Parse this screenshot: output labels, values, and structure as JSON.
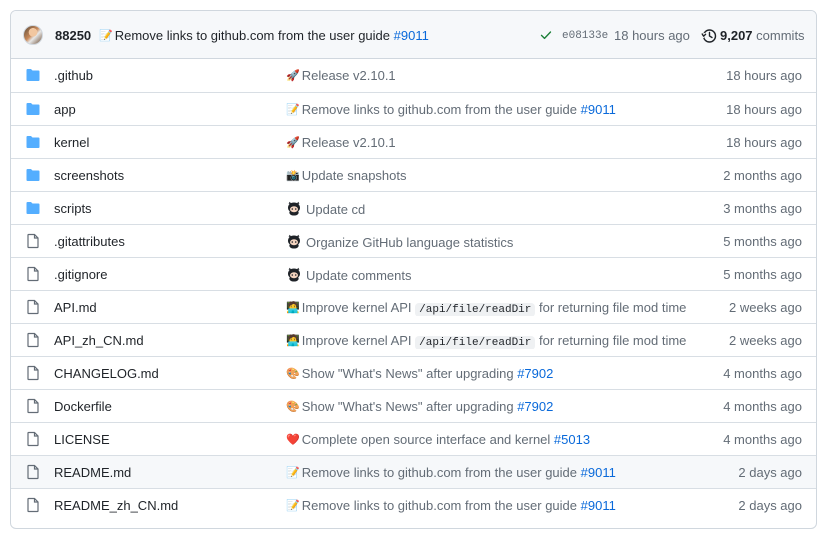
{
  "commit": {
    "author": "88250",
    "emoji": "📝",
    "message": "Remove links to github.com from the user guide",
    "pr": "#9011",
    "sha": "e08133e",
    "time": "18 hours ago",
    "commit_count": "9,207",
    "commits_label": "commits"
  },
  "files": [
    {
      "name": ".github",
      "type": "folder",
      "emoji": "🚀",
      "message": "Release v2.10.1",
      "link": "",
      "time": "18 hours ago"
    },
    {
      "name": "app",
      "type": "folder",
      "emoji": "📝",
      "message": "Remove links to github.com from the user guide",
      "link": "#9011",
      "time": "18 hours ago"
    },
    {
      "name": "kernel",
      "type": "folder",
      "emoji": "🚀",
      "message": "Release v2.10.1",
      "link": "",
      "time": "18 hours ago"
    },
    {
      "name": "screenshots",
      "type": "folder",
      "emoji": "📸",
      "message": "Update snapshots",
      "link": "",
      "time": "2 months ago"
    },
    {
      "name": "scripts",
      "type": "folder",
      "emoji": "octocat",
      "message": "Update cd",
      "link": "",
      "time": "3 months ago"
    },
    {
      "name": ".gitattributes",
      "type": "file",
      "emoji": "octocat",
      "message": "Organize GitHub language statistics",
      "link": "",
      "time": "5 months ago"
    },
    {
      "name": ".gitignore",
      "type": "file",
      "emoji": "octocat",
      "message": "Update comments",
      "link": "",
      "time": "5 months ago"
    },
    {
      "name": "API.md",
      "type": "file",
      "emoji": "🧑‍💻",
      "message": "Improve kernel API",
      "code": "/api/file/readDir",
      "message_after": "for returning file mod time",
      "link": "",
      "time": "2 weeks ago"
    },
    {
      "name": "API_zh_CN.md",
      "type": "file",
      "emoji": "🧑‍💻",
      "message": "Improve kernel API",
      "code": "/api/file/readDir",
      "message_after": "for returning file mod time",
      "link": "",
      "time": "2 weeks ago"
    },
    {
      "name": "CHANGELOG.md",
      "type": "file",
      "emoji": "🎨",
      "message": "Show \"What's News\" after upgrading",
      "link": "#7902",
      "time": "4 months ago"
    },
    {
      "name": "Dockerfile",
      "type": "file",
      "emoji": "🎨",
      "message": "Show \"What's News\" after upgrading",
      "link": "#7902",
      "time": "4 months ago"
    },
    {
      "name": "LICENSE",
      "type": "file",
      "emoji": "❤️",
      "message": "Complete open source interface and kernel",
      "link": "#5013",
      "time": "4 months ago"
    },
    {
      "name": "README.md",
      "type": "file",
      "emoji": "📝",
      "message": "Remove links to github.com from the user guide",
      "link": "#9011",
      "time": "2 days ago"
    },
    {
      "name": "README_zh_CN.md",
      "type": "file",
      "emoji": "📝",
      "message": "Remove links to github.com from the user guide",
      "link": "#9011",
      "time": "2 days ago"
    }
  ],
  "colors": {
    "link": "#0969da",
    "folder": "#54aeff",
    "muted": "#636c76",
    "check": "#1a7f37"
  }
}
